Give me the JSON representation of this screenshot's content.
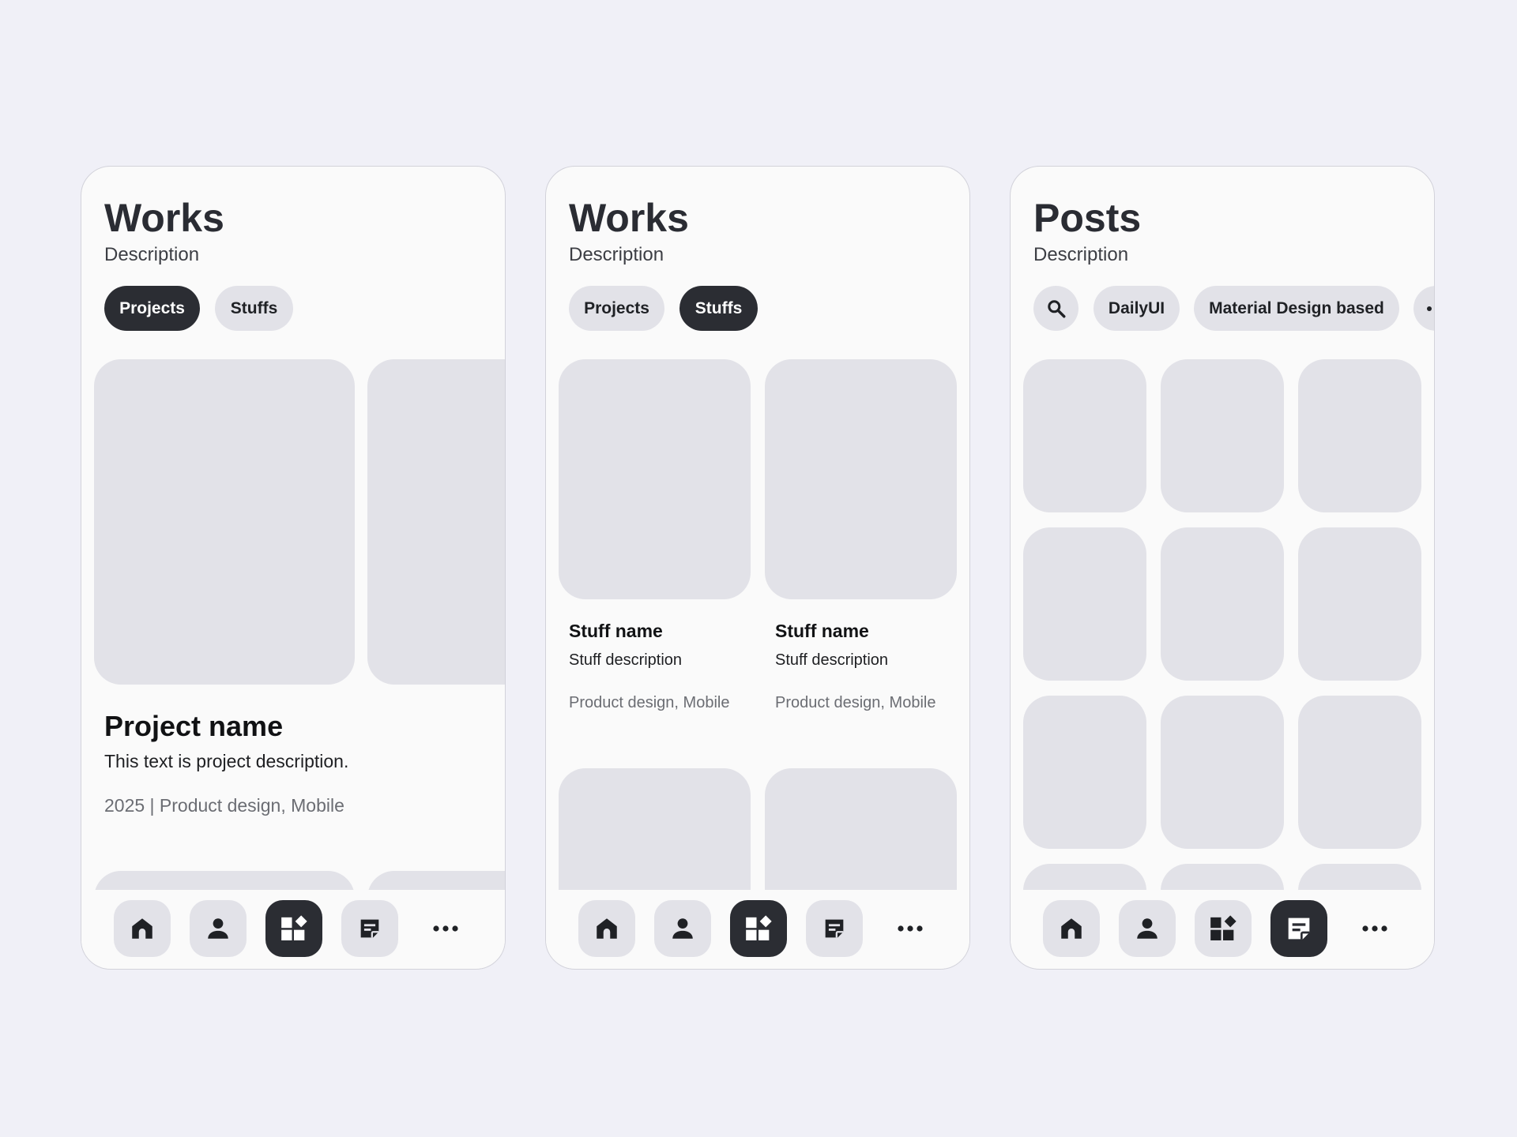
{
  "screens": [
    {
      "title": "Works",
      "description": "Description",
      "chips": [
        "Projects",
        "Stuffs"
      ],
      "active_chip": "Projects",
      "project": {
        "name": "Project name",
        "description": "This text is project description.",
        "meta": "2025 | Product design, Mobile"
      }
    },
    {
      "title": "Works",
      "description": "Description",
      "chips": [
        "Projects",
        "Stuffs"
      ],
      "active_chip": "Stuffs",
      "stuffs": [
        {
          "name": "Stuff name",
          "description": "Stuff description",
          "meta": "Product design, Mobile"
        },
        {
          "name": "Stuff name",
          "description": "Stuff description",
          "meta": "Product design, Mobile"
        }
      ]
    },
    {
      "title": "Posts",
      "description": "Description",
      "chips": [
        "DailyUI",
        "Material Design based"
      ],
      "search_icon": "search-icon",
      "more_chip_icon": "more-horizontal-icon"
    }
  ],
  "navbar": {
    "items": [
      "home-icon",
      "person-icon",
      "widgets-icon",
      "sticky-note-icon",
      "more-horizontal-icon"
    ],
    "active_by_screen": [
      "widgets-icon",
      "widgets-icon",
      "sticky-note-icon"
    ]
  },
  "colors": {
    "background": "#f0f0f7",
    "card": "#fafafa",
    "placeholder": "#e2e2e8",
    "active": "#2b2d33"
  }
}
